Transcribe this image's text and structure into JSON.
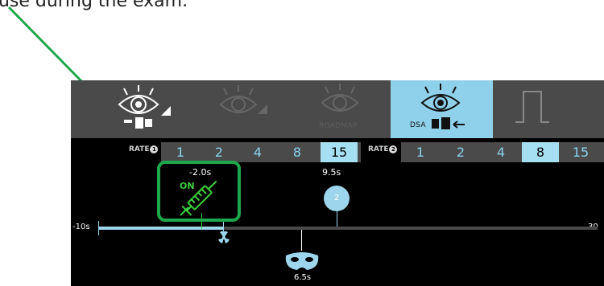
{
  "caption": "use during the exam.",
  "modes": [
    {
      "name": "fluoro-store",
      "label": "",
      "selected": false
    },
    {
      "name": "fluoro",
      "label": "",
      "selected": false
    },
    {
      "name": "roadmap",
      "label": "ROADMAP",
      "selected": false
    },
    {
      "name": "dsa",
      "label": "DSA",
      "selected": true
    },
    {
      "name": "pulse",
      "label": "",
      "selected": false
    }
  ],
  "rates": [
    {
      "label": "RATE",
      "badge": "1",
      "values": [
        "1",
        "2",
        "4",
        "8",
        "15"
      ],
      "selected": "15"
    },
    {
      "label": "RATE",
      "badge": "2",
      "values": [
        "1",
        "2",
        "4",
        "8",
        "15"
      ],
      "selected": "8"
    }
  ],
  "timeline": {
    "start_label": "-10s",
    "end_label": "30",
    "injection": {
      "time": "-2.0s",
      "state": "ON"
    },
    "phase2": {
      "time": "9.5s",
      "number": "2"
    },
    "mask": {
      "time": "6.5s"
    }
  },
  "colors": {
    "accent": "#9dd6ec",
    "highlight": "#1ea64b",
    "on": "#3dcf3d",
    "bar": "#4a4a4a"
  }
}
